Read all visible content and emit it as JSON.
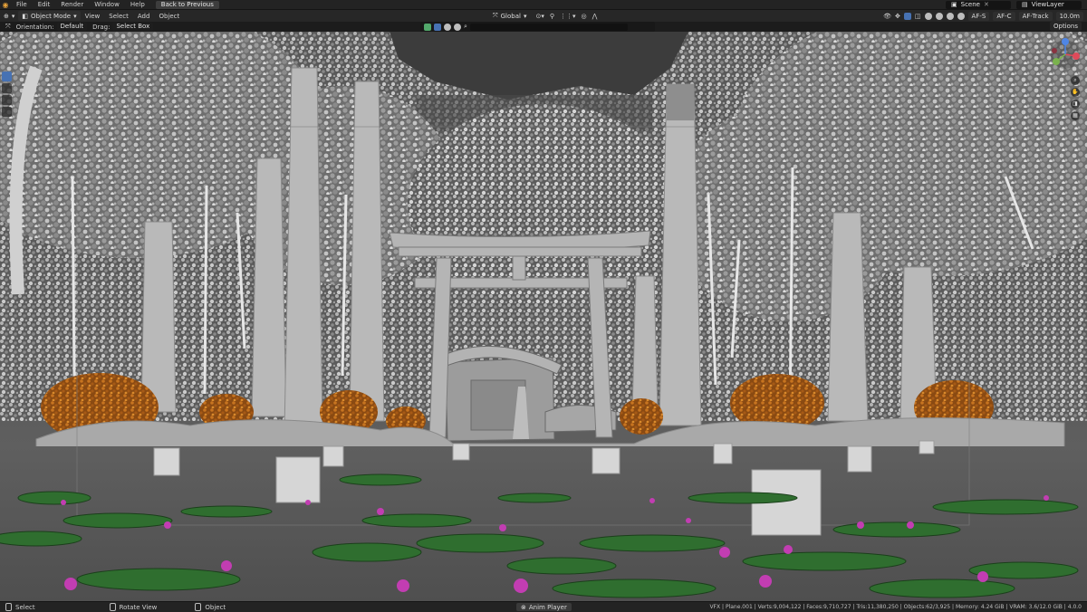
{
  "menubar": {
    "logo_icon": "blender-logo-icon",
    "items": [
      "File",
      "Edit",
      "Render",
      "Window",
      "Help"
    ],
    "back_button": "Back to Previous",
    "scene_field": "Scene",
    "view_layer_field": "ViewLayer"
  },
  "toolbar": {
    "mode": "Object Mode",
    "menus": [
      "View",
      "Select",
      "Add",
      "Object"
    ],
    "transform_orientation": "Global",
    "right_labels": [
      "AF-S",
      "AF-C",
      "AF-Track",
      "10.0m"
    ]
  },
  "tool_settings": {
    "orientation_label": "Orientation:",
    "orientation_value": "Default",
    "drag_label": "Drag:",
    "drag_value": "Select Box",
    "options": "Options"
  },
  "viewport": {
    "scene": "forest torii gate shrine with lily pond, solid viewport shading"
  },
  "statusbar": {
    "select": "Select",
    "rotate_view": "Rotate View",
    "object": "Object",
    "active_object": "Anim Player",
    "stats": "VFX | Plane.001 | Verts:9,004,122 | Faces:9,710,727 | Tris:11,380,250 | Objects:62/3,925 | Memory: 4.24 GiB | VRAM: 3.6/12.0 GiB | 4.0.0"
  },
  "colors": {
    "accent": "#4772b3",
    "autumn_foliage": "#b4651a",
    "lily_pad": "#2d6b2d",
    "lotus": "#c43fb4"
  }
}
